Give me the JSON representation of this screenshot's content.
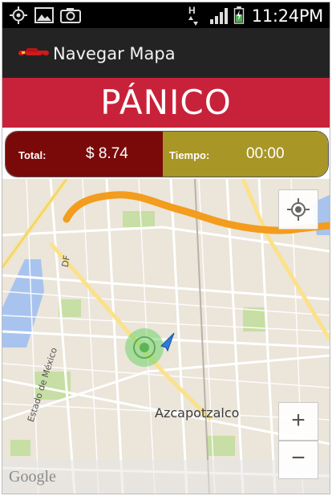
{
  "status_bar": {
    "time": "11:24PM",
    "network_label": "H",
    "icons": [
      "gps-icon",
      "image-icon",
      "camera-icon",
      "hspa-signal-icon",
      "signal-bars-icon",
      "battery-charging-icon"
    ]
  },
  "action_bar": {
    "title": "Navegar Mapa",
    "app_icon": "car-icon"
  },
  "panic_button": {
    "label": "PÁNICO"
  },
  "trip_info": {
    "total_label": "Total:",
    "total_value": "$ 8.74",
    "time_label": "Tiempo:",
    "time_value": "00:00",
    "colors": {
      "total_bg": "#7a0a0a",
      "time_bg": "#a89626"
    }
  },
  "map": {
    "place_label": "Azcapotzalco",
    "street_labels": [
      "Estado de México",
      "DF"
    ],
    "attribution": "Google",
    "controls": {
      "my_location_icon": "crosshair-icon",
      "zoom_in": "+",
      "zoom_out": "−"
    },
    "colors": {
      "highway": "#f39c1d",
      "water": "#a8c4ee",
      "park": "#c7dea4"
    }
  }
}
